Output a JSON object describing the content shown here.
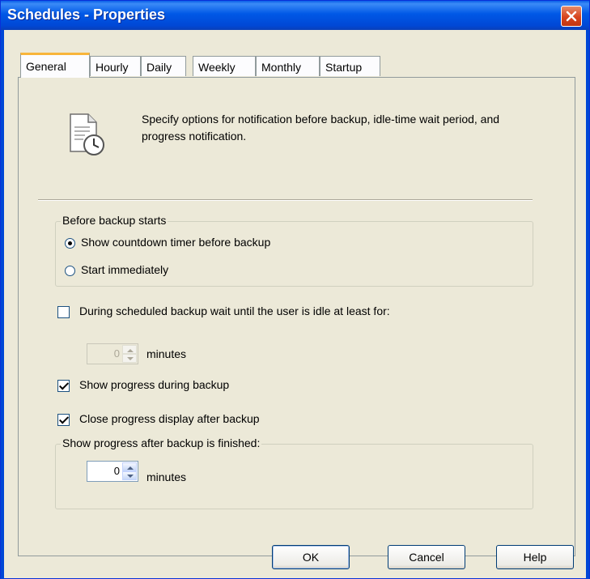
{
  "window": {
    "title": "Schedules - Properties"
  },
  "tabs": [
    {
      "label": "General"
    },
    {
      "label": "Hourly"
    },
    {
      "label": "Daily"
    },
    {
      "label": "Weekly"
    },
    {
      "label": "Monthly"
    },
    {
      "label": "Startup"
    }
  ],
  "general": {
    "description": "Specify options for notification before backup, idle-time wait period, and progress notification.",
    "before_group": {
      "label": "Before backup starts",
      "options": [
        {
          "label": "Show countdown timer before backup",
          "checked": true
        },
        {
          "label": "Start immediately",
          "checked": false
        }
      ]
    },
    "idle": {
      "label": "During scheduled backup wait until the user is idle at least for:",
      "checked": false,
      "minutes_value": "0",
      "minutes_label": "minutes"
    },
    "show_progress": {
      "label": "Show progress during backup",
      "checked": true
    },
    "close_progress": {
      "label": "Close progress display after backup",
      "checked": true
    },
    "after_group": {
      "label": "Show progress after backup is finished:",
      "minutes_value": "0",
      "minutes_label": "minutes"
    }
  },
  "buttons": {
    "ok": "OK",
    "cancel": "Cancel",
    "help": "Help"
  },
  "colors": {
    "titlebar": "#0058e6",
    "face": "#ece9d8",
    "close": "#d8441d",
    "active_tab_accent": "#f8b53a"
  }
}
